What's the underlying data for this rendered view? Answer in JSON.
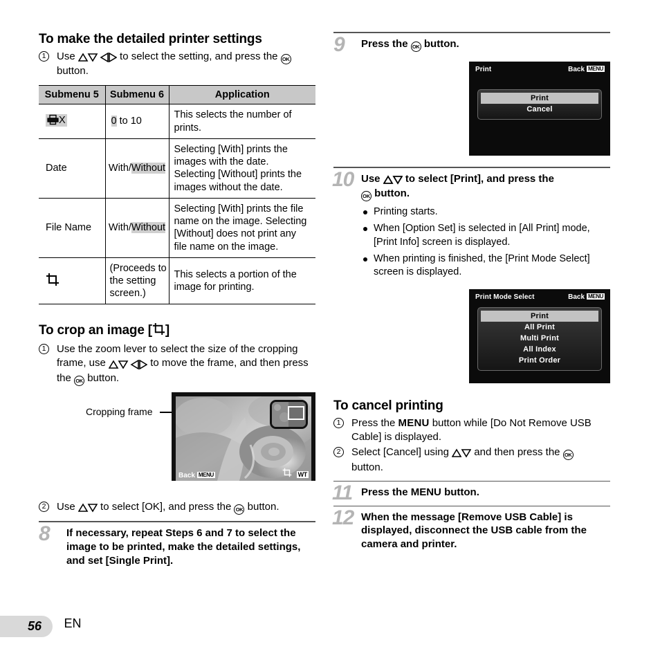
{
  "page": {
    "number": "56",
    "language": "EN"
  },
  "left": {
    "section1_title": "To make the detailed printer settings",
    "step1_pre": "Use",
    "step1_mid": "to select the setting, and press the",
    "step1_post": "button.",
    "table": {
      "headers": [
        "Submenu 5",
        "Submenu 6",
        "Application"
      ],
      "rows": [
        {
          "submenu5_icon": "printer-x-icon",
          "submenu5": "X",
          "submenu6_highlight": "0",
          "submenu6_rest": " to 10",
          "application": "This selects the number of prints."
        },
        {
          "submenu5": "Date",
          "submenu6_plain": "With/",
          "submenu6_highlight": "Without",
          "application": "Selecting [With] prints the images with the date. Selecting [Without] prints the images without the date."
        },
        {
          "submenu5": "File Name",
          "submenu6_plain": "With/",
          "submenu6_highlight": "Without",
          "application": "Selecting [With] prints the file name on the image. Selecting [Without] does not print any file name on the image."
        },
        {
          "submenu5_icon": "crop-icon",
          "submenu5": "",
          "submenu6": "(Proceeds to the setting screen.)",
          "application": "This selects a portion of the image for printing."
        }
      ]
    },
    "section2_title_pre": "To crop an image [",
    "section2_title_post": "]",
    "crop_step1_a": "Use the zoom lever to select the size of the cropping frame, use",
    "crop_step1_b": "to move the frame, and then press the",
    "crop_step1_c": "button.",
    "figure": {
      "label": "Cropping frame",
      "lcd_back": "Back",
      "lcd_menu_badge": "MENU",
      "lcd_wt_badge": "WT",
      "lcd_crop_icon": "crop-icon"
    },
    "crop_step2_a": "Use",
    "crop_step2_b": "to select [OK], and press the",
    "crop_step2_c": "button.",
    "step8": {
      "number": "8",
      "text": "If necessary, repeat Steps 6 and 7 to select the image to be printed, make the detailed settings, and set [Single Print]."
    }
  },
  "right": {
    "step9": {
      "number": "9",
      "text_pre": "Press the",
      "text_post": "button."
    },
    "print_dialog": {
      "title": "Print",
      "back_label": "Back",
      "menu_badge": "MENU",
      "items": [
        "Print",
        "Cancel"
      ],
      "selected_index": 0
    },
    "step10": {
      "number": "10",
      "text_pre": "Use",
      "text_mid": "to select [Print], and press the",
      "text_post": "button.",
      "bullets": [
        "Printing starts.",
        "When [Option Set] is selected in [All Print] mode, [Print Info] screen is displayed.",
        "When printing is finished, the [Print Mode Select] screen is displayed."
      ]
    },
    "print_mode_dialog": {
      "title": "Print Mode Select",
      "back_label": "Back",
      "menu_badge": "MENU",
      "items": [
        "Print",
        "All Print",
        "Multi Print",
        "All Index",
        "Print Order"
      ],
      "selected_index": 0
    },
    "cancel_section_title": "To cancel printing",
    "cancel_step1_a": "Press the",
    "cancel_step1_menu": "MENU",
    "cancel_step1_b": "button while [Do Not Remove USB Cable]  is displayed.",
    "cancel_step2_a": "Select [Cancel] using",
    "cancel_step2_b": "and then press the",
    "cancel_step2_c": "button.",
    "step11": {
      "number": "11",
      "text_pre": "Press the",
      "text_menu": "MENU",
      "text_post": "button."
    },
    "step12": {
      "number": "12",
      "text": "When the message [Remove USB Cable] is displayed, disconnect the USB cable from the camera and printer."
    }
  }
}
